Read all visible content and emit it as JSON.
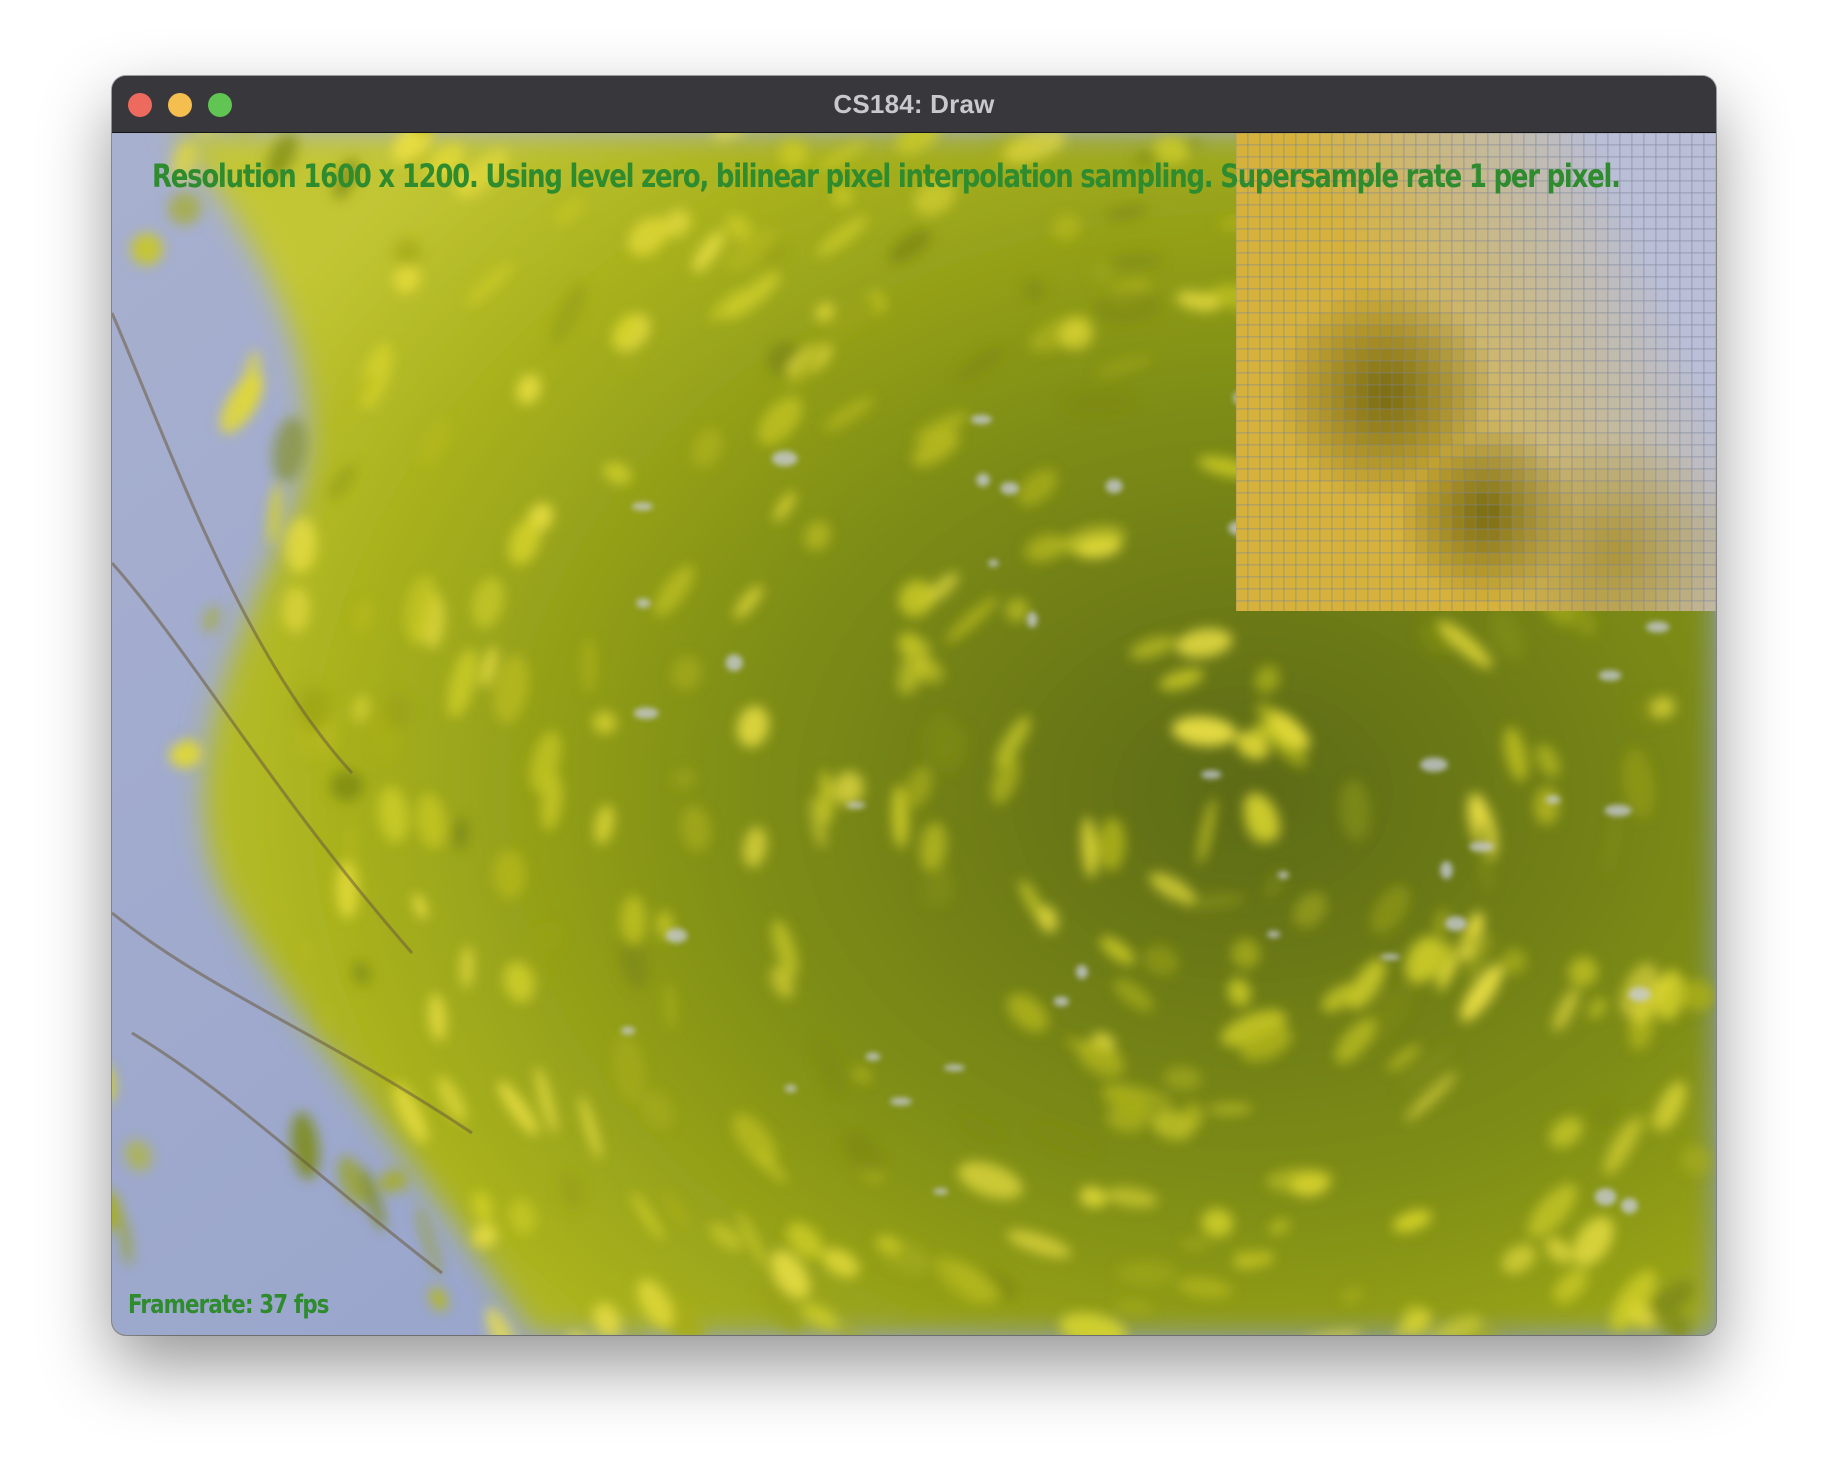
{
  "window": {
    "title": "CS184: Draw",
    "traffic_lights": {
      "close_color": "#ed6a5e",
      "minimize_color": "#f5bf4f",
      "maximize_color": "#61c554"
    }
  },
  "canvas": {
    "status_text": "Resolution 1600 x 1200. Using level zero, bilinear pixel interpolation sampling. Supersample rate 1 per pixel.",
    "framerate_text": "Framerate: 37 fps",
    "overlay_text_color": "#2e8b2e",
    "scene": "rotated photo of yellow-green tree foliage against blue sky",
    "zoom_inset": "magnified pixel grid of foliage"
  }
}
